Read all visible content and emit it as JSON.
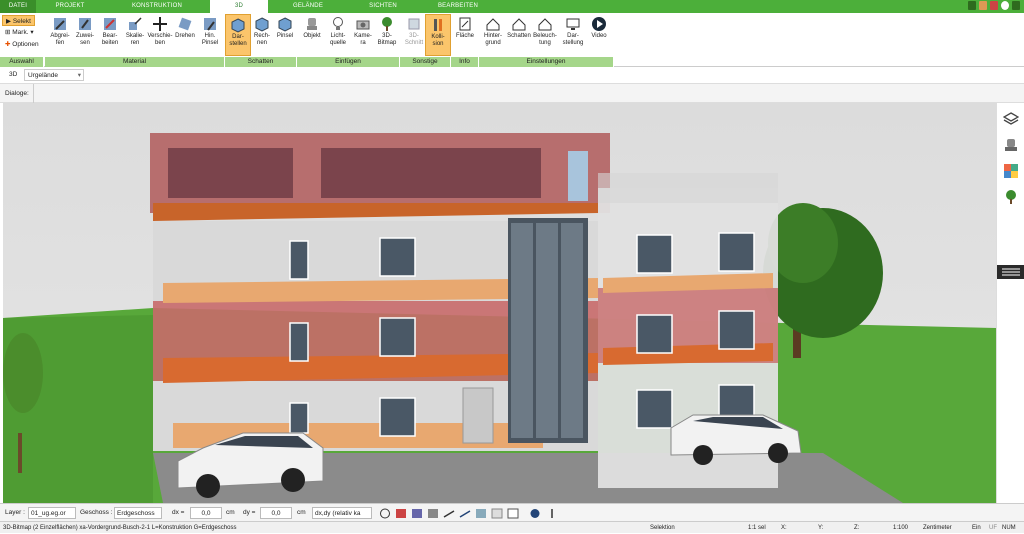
{
  "tabs": [
    {
      "label": "DATEI"
    },
    {
      "label": "PROJEKT"
    },
    {
      "label": "KONSTRUKTION"
    },
    {
      "label": "3D"
    },
    {
      "label": "GELÄNDE"
    },
    {
      "label": "SICHTEN"
    },
    {
      "label": "BEARBEITEN"
    }
  ],
  "ribbon": {
    "auswahl": {
      "label": "Auswahl",
      "selekt": "Selekt",
      "mark": "Mark.",
      "optionen": "Optionen"
    },
    "material": {
      "label": "Material",
      "buttons": [
        {
          "label": "Abgrei-\nfen",
          "icon": "eyedropper-icon"
        },
        {
          "label": "Zuwei-\nsen",
          "icon": "paint-bucket-icon"
        },
        {
          "label": "Bear-\nbeiten",
          "icon": "edit-material-icon"
        },
        {
          "label": "Skalie-\nren",
          "icon": "scale-icon"
        },
        {
          "label": "Verschie-\nben",
          "icon": "move-icon"
        },
        {
          "label": "Drehen",
          "icon": "rotate-icon"
        },
        {
          "label": "Hin.\nPinsel",
          "icon": "brush-icon"
        }
      ]
    },
    "schatten": {
      "label": "Schatten",
      "buttons": [
        {
          "label": "Dar-\nstellen",
          "icon": "cube-shade-icon"
        },
        {
          "label": "Rech-\nnen",
          "icon": "cube-calc-icon"
        },
        {
          "label": "Pinsel",
          "icon": "cube-brush-icon"
        }
      ]
    },
    "einfuegen": {
      "label": "Einfügen",
      "buttons": [
        {
          "label": "Objekt",
          "icon": "chair-icon"
        },
        {
          "label": "Licht-\nquelle",
          "icon": "lightbulb-icon"
        },
        {
          "label": "Kame-\nra",
          "icon": "camera-icon"
        },
        {
          "label": "3D-\nBitmap",
          "icon": "tree-icon"
        }
      ]
    },
    "sonstige": {
      "label": "Sonstige",
      "buttons": [
        {
          "label": "3D-\nSchnitt",
          "icon": "section-icon"
        },
        {
          "label": "Kolli-\nsion",
          "icon": "collision-icon"
        }
      ]
    },
    "info": {
      "label": "Info",
      "buttons": [
        {
          "label": "Fläche",
          "icon": "area-icon"
        }
      ]
    },
    "einstellungen": {
      "label": "Einstellungen",
      "buttons": [
        {
          "label": "Hinter-\ngrund",
          "icon": "background-icon"
        },
        {
          "label": "Schatten",
          "icon": "house-shadow-icon"
        },
        {
          "label": "Beleuch-\ntung",
          "icon": "house-light-icon"
        },
        {
          "label": "Dar-\nstellung",
          "icon": "monitor-icon"
        },
        {
          "label": "Video",
          "icon": "play-icon"
        }
      ]
    }
  },
  "viewbar": {
    "mode": "3D",
    "view": "Urgelände"
  },
  "dialogbar": {
    "label": "Dialoge:"
  },
  "bottombar": {
    "layer_label": "Layer :",
    "layer_value": "01_ug.eg.or",
    "geschoss_label": "Geschoss :",
    "geschoss_value": "Erdgeschoss",
    "dx_label": "dx =",
    "dx_value": "0,0",
    "dx_unit": "cm",
    "dy_label": "dy =",
    "dy_value": "0,0",
    "dy_unit": "cm",
    "mode_value": "dx,dy (relativ ka"
  },
  "statusbar": {
    "info": "3D-Bitmap (2 Einzelflächen) xa-Vordergrund-Busch-2-1 L=Konstruktion G=Erdgeschoss",
    "mode": "Selektion",
    "sel": "1:1 sel",
    "x": "X:",
    "y": "Y:",
    "z": "Z:",
    "scale": "1:100",
    "unit": "Zentimeter",
    "ein": "Ein",
    "uf": "UF",
    "num": "NUM"
  },
  "colors": {
    "accent": "#4caf3a",
    "group_bar": "#a5d68a",
    "active_button": "#fbc56b"
  }
}
